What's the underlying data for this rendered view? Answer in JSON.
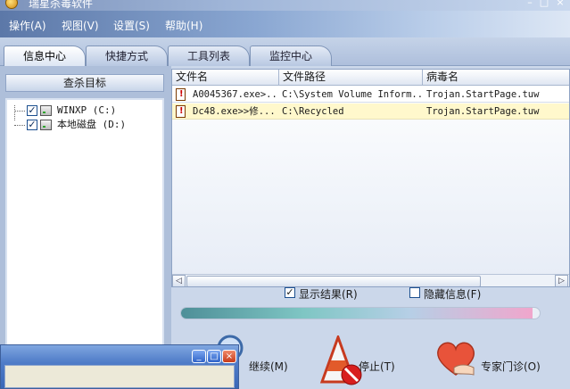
{
  "window": {
    "title": "瑞星杀毒软件"
  },
  "menu": [
    {
      "label": "操作(A)"
    },
    {
      "label": "视图(V)"
    },
    {
      "label": "设置(S)"
    },
    {
      "label": "帮助(H)"
    }
  ],
  "tabs": [
    {
      "label": "信息中心",
      "active": true
    },
    {
      "label": "快捷方式",
      "active": false
    },
    {
      "label": "工具列表",
      "active": false
    },
    {
      "label": "监控中心",
      "active": false
    }
  ],
  "scan_target": {
    "header": "查杀目标",
    "drives": [
      {
        "label": "WINXP (C:)",
        "checked": true
      },
      {
        "label": "本地磁盘 (D:)",
        "checked": true
      }
    ]
  },
  "results": {
    "columns": [
      "文件名",
      "文件路径",
      "病毒名"
    ],
    "rows": [
      {
        "file": "A0045367.exe>...",
        "path": "C:\\System Volume Inform...",
        "virus": "Trojan.StartPage.tuw"
      },
      {
        "file": "Dc48.exe>>修...",
        "path": "C:\\Recycled",
        "virus": "Trojan.StartPage.tuw"
      }
    ]
  },
  "options": {
    "show_results": {
      "label": "显示结果(R)",
      "checked": true
    },
    "hide_info": {
      "label": "隐藏信息(F)",
      "checked": false
    }
  },
  "progress": {
    "value": 0.98
  },
  "actions": {
    "continue": "继续(M)",
    "stop": "停止(T)",
    "expert": "专家门诊(O)"
  },
  "colors": {
    "accent": "#5c78a8",
    "highlight_row": "#fff8cc"
  }
}
